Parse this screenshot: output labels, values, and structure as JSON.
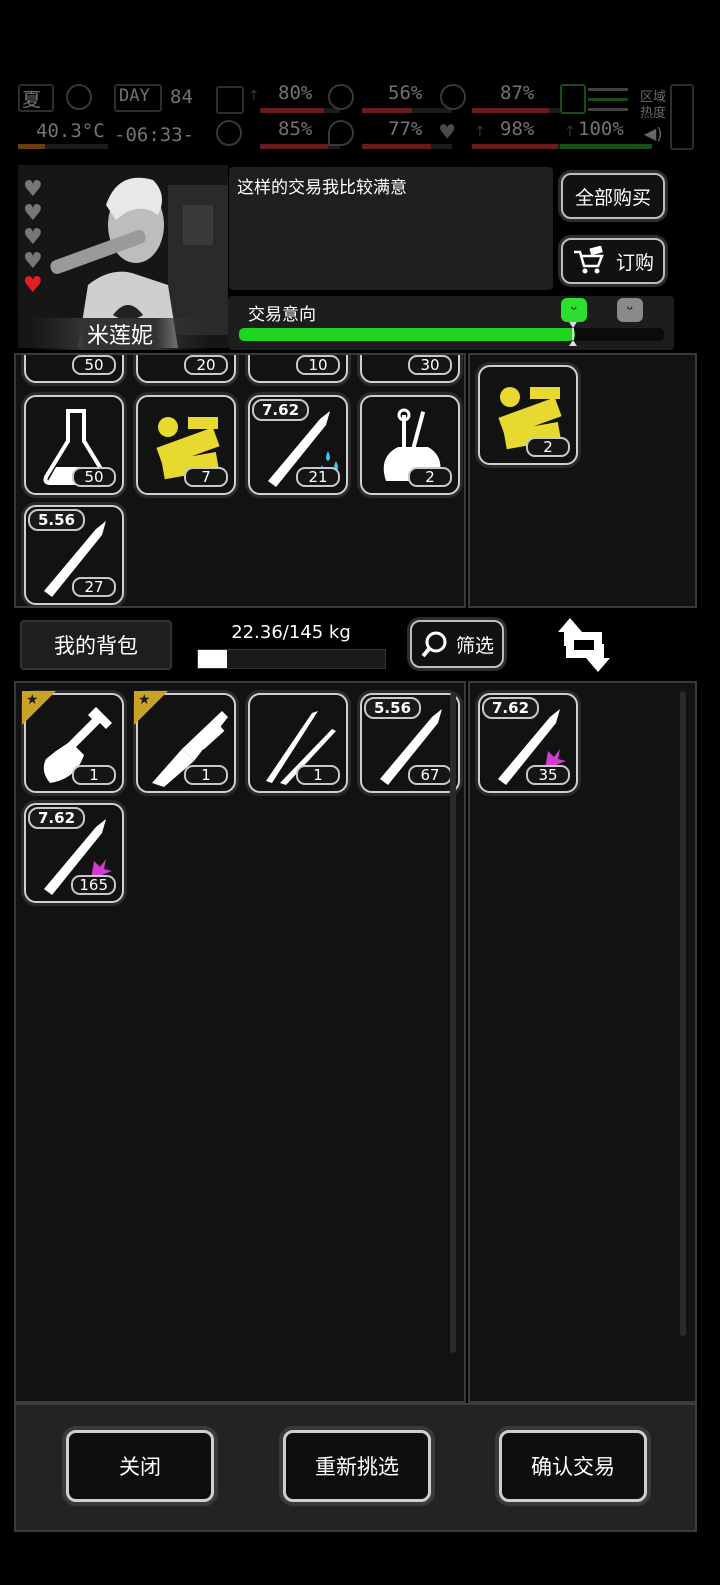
{
  "hud": {
    "season": "夏",
    "temperature": "40.3°C",
    "day_label": "DAY",
    "day_number": "84",
    "time": "-06:33-",
    "stats": [
      {
        "name": "health",
        "value": "80%"
      },
      {
        "name": "hunger",
        "value": "56%"
      },
      {
        "name": "stamina",
        "value": "87%"
      },
      {
        "name": "mood",
        "value": "85%"
      },
      {
        "name": "thirst",
        "value": "77%"
      },
      {
        "name": "heart",
        "value": "98%"
      },
      {
        "name": "energy",
        "value": "100%"
      }
    ],
    "zone_label": "区域",
    "heat_label": "热度"
  },
  "npc": {
    "name": "米莲妮",
    "hearts_total": 5,
    "hearts_filled": 1,
    "dialog": "这样的交易我比较满意"
  },
  "buttons": {
    "buy_all": "全部购买",
    "order": "订购",
    "filter": "筛选",
    "close": "关闭",
    "reselect": "重新挑选",
    "confirm": "确认交易"
  },
  "trade_intent": {
    "label": "交易意向",
    "level": 0.79
  },
  "merchant_inventory": {
    "partial_row_counts": [
      "50",
      "20",
      "10",
      "30"
    ],
    "items": [
      {
        "icon": "flask-icon",
        "count": "50"
      },
      {
        "icon": "golden-machine-parts-icon",
        "count": "7"
      },
      {
        "icon": "bullet-water-icon",
        "caliber": "7.62",
        "count": "21"
      },
      {
        "icon": "tool-pouch-icon",
        "count": "2"
      },
      {
        "icon": "bullet-icon",
        "caliber": "5.56",
        "count": "27"
      }
    ]
  },
  "merchant_offer": [
    {
      "icon": "golden-machine-parts-icon",
      "count": "2"
    }
  ],
  "bag": {
    "label": "我的背包",
    "weight": "22.36/145 kg",
    "weight_fraction": 0.154,
    "items": [
      {
        "icon": "shovel-icon",
        "count": "1",
        "starred": true
      },
      {
        "icon": "knife-icon",
        "count": "1",
        "starred": true
      },
      {
        "icon": "tweezers-icon",
        "count": "1"
      },
      {
        "icon": "bullet-icon",
        "caliber": "5.56",
        "count": "67"
      },
      {
        "icon": "bullet-spark-icon",
        "caliber": "7.62",
        "count": "165"
      }
    ]
  },
  "player_offer": [
    {
      "icon": "bullet-spark-icon",
      "caliber": "7.62",
      "count": "35"
    }
  ]
}
